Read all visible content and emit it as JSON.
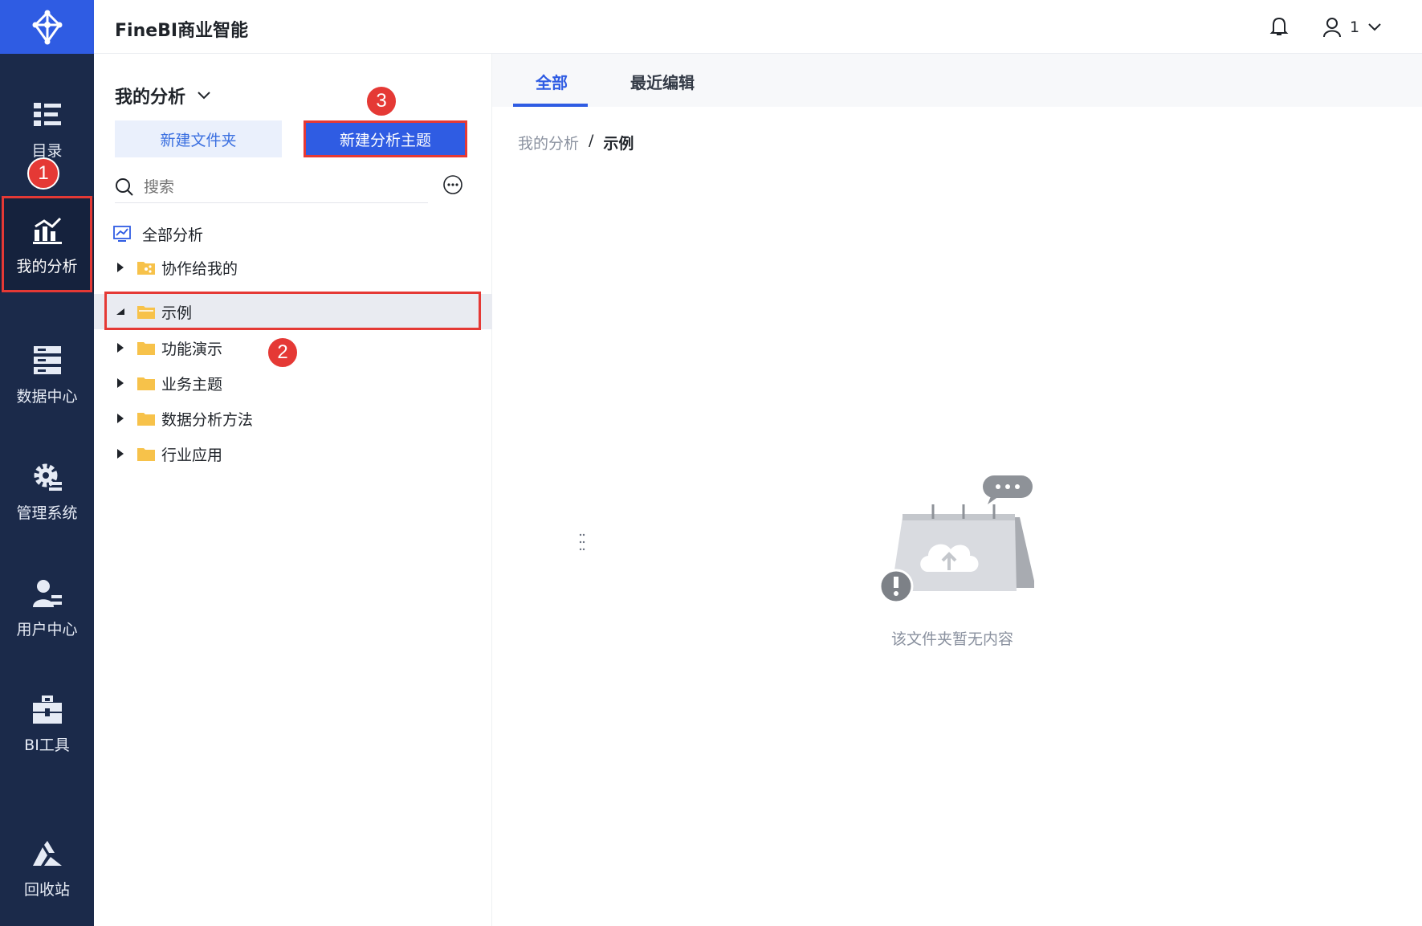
{
  "app": {
    "title": "FineBI商业智能"
  },
  "header": {
    "user_name": "1"
  },
  "rail": {
    "items": [
      {
        "label": "目录",
        "icon": "catalog-icon"
      },
      {
        "label": "我的分析",
        "icon": "analysis-chart-icon"
      },
      {
        "label": "数据中心",
        "icon": "data-center-icon"
      },
      {
        "label": "管理系统",
        "icon": "gear-icon"
      },
      {
        "label": "用户中心",
        "icon": "user-center-icon"
      },
      {
        "label": "BI工具",
        "icon": "toolbox-icon"
      },
      {
        "label": "回收站",
        "icon": "recycle-icon"
      }
    ],
    "active": "我的分析"
  },
  "panel": {
    "title": "我的分析",
    "new_folder_label": "新建文件夹",
    "new_theme_label": "新建分析主题",
    "search_placeholder": "搜索",
    "tree": {
      "root_label": "全部分析",
      "items": [
        {
          "label": "协作给我的",
          "expanded": false
        },
        {
          "label": "示例",
          "expanded": true,
          "selected": true
        },
        {
          "label": "功能演示",
          "expanded": false
        },
        {
          "label": "业务主题",
          "expanded": false
        },
        {
          "label": "数据分析方法",
          "expanded": false
        },
        {
          "label": "行业应用",
          "expanded": false
        }
      ]
    }
  },
  "content": {
    "tabs": [
      {
        "label": "全部",
        "active": true
      },
      {
        "label": "最近编辑",
        "active": false
      }
    ],
    "breadcrumb": {
      "parent": "我的分析",
      "separator": "/",
      "current": "示例"
    },
    "empty_message": "该文件夹暂无内容"
  },
  "annotations": {
    "step1": "1",
    "step2": "2",
    "step3": "3"
  },
  "colors": {
    "primary": "#2f5ce3",
    "rail_bg": "#1b2a4a",
    "highlight_red": "#e53935",
    "folder_yellow": "#f7c24a"
  }
}
